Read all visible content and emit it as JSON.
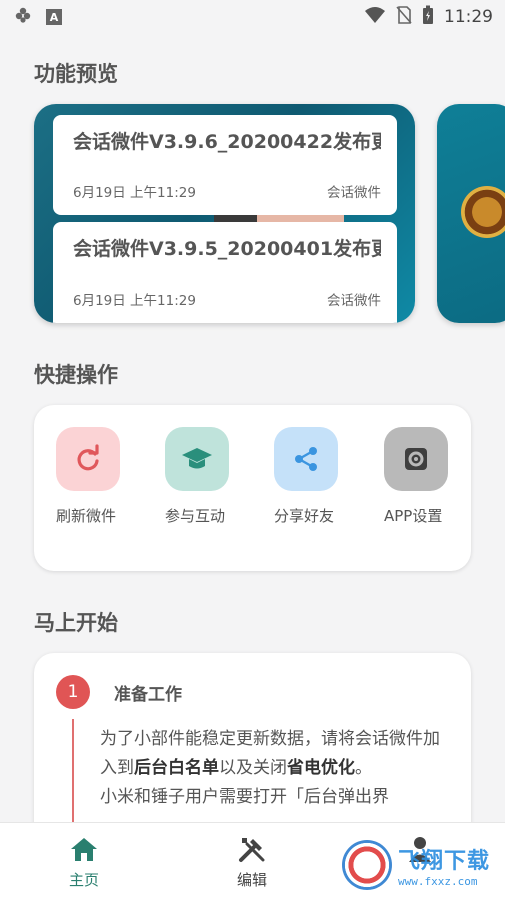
{
  "status_bar": {
    "time": "11:29",
    "icons": [
      "flower-icon",
      "a-box-icon",
      "wifi-icon",
      "no-sim-icon",
      "battery-charging-icon"
    ],
    "a_glyph": "A"
  },
  "sections": {
    "preview_title": "功能预览",
    "quick_title": "快捷操作",
    "start_title": "马上开始"
  },
  "preview": {
    "items": [
      {
        "title": "会话微件V3.9.6_20200422发布更",
        "date": "6月19日 上午11:29",
        "source": "会话微件"
      },
      {
        "title": "会话微件V3.9.5_20200401发布更",
        "date": "6月19日 上午11:29",
        "source": "会话微件"
      }
    ]
  },
  "quick_actions": [
    {
      "label": "刷新微件",
      "icon": "refresh-icon",
      "bg": "#fbd3d5",
      "fg": "#e0575b"
    },
    {
      "label": "参与互动",
      "icon": "graduation-cap-icon",
      "bg": "#bfe3db",
      "fg": "#2a8f7c"
    },
    {
      "label": "分享好友",
      "icon": "share-icon",
      "bg": "#c5e1f9",
      "fg": "#3b95e0"
    },
    {
      "label": "APP设置",
      "icon": "settings-icon",
      "bg": "#b9b9b9",
      "fg": "#4a4a4a"
    }
  ],
  "start": {
    "step_number": "1",
    "step_title": "准备工作",
    "body_parts": {
      "p1": "为了小部件能稳定更新数据，请将会话微件加入到",
      "b1": "后台白名单",
      "p2": "以及关闭",
      "b2": "省电优化",
      "p3": "。",
      "line2": "小米和锤子用户需要打开「后台弹出界"
    }
  },
  "bottom_nav": {
    "home": "主页",
    "edit": "编辑"
  },
  "watermark": {
    "title": "飞翔下载",
    "sub": "www.fxxz.com"
  },
  "colors": {
    "accent": "#2a7f6f",
    "card_teal": "#0f5a71",
    "step_red": "#e05555"
  }
}
